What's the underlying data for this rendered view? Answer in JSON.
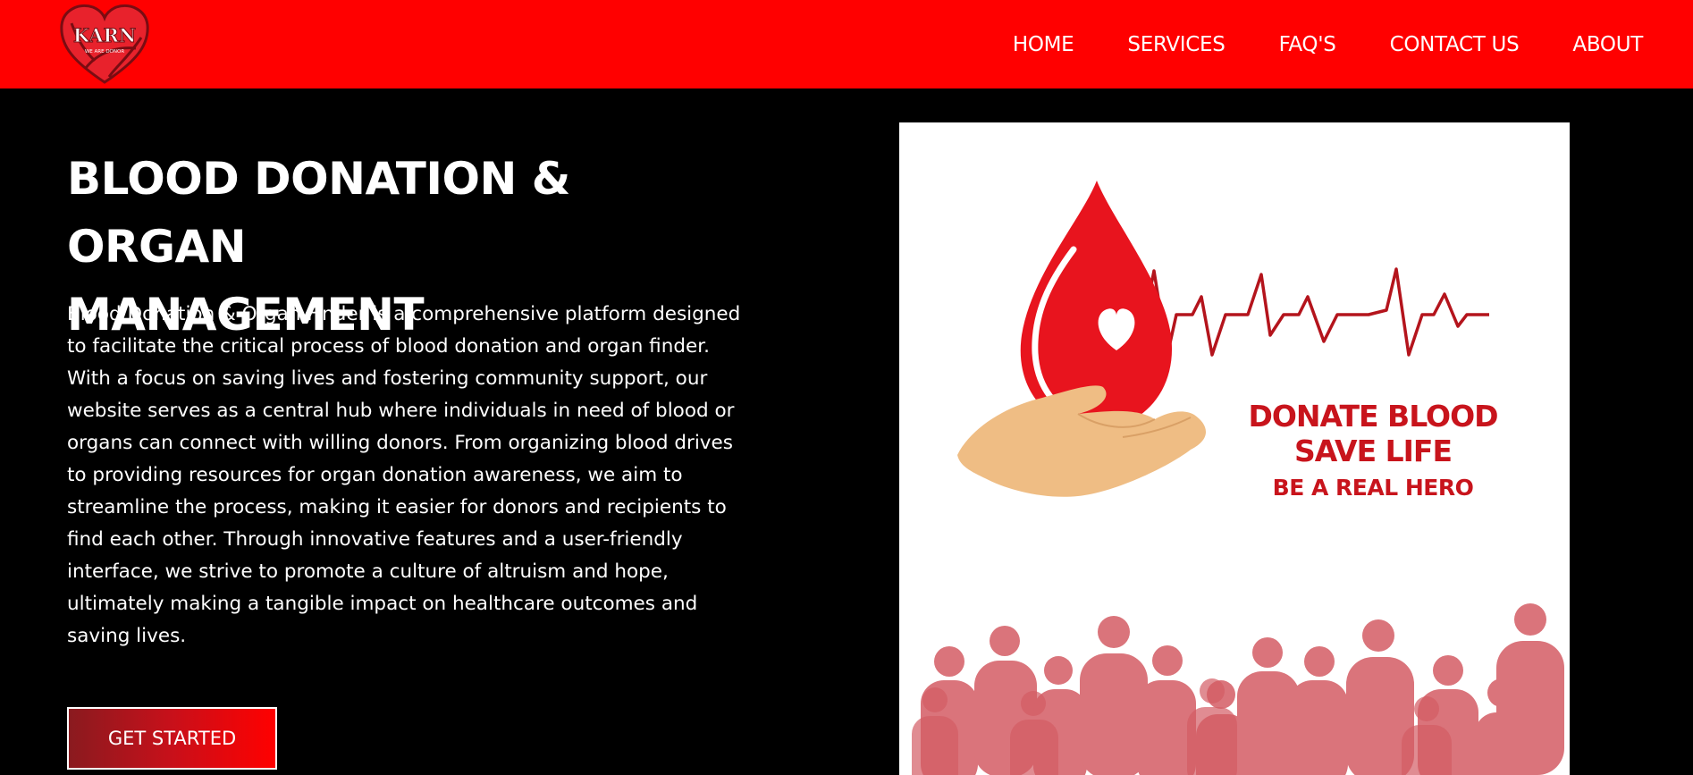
{
  "header": {
    "logo_text": "KARN",
    "logo_tagline": "WE ARE DONOR",
    "nav": [
      {
        "label": "HOME"
      },
      {
        "label": "SERVICES"
      },
      {
        "label": "FAQ'S"
      },
      {
        "label": "CONTACT US"
      },
      {
        "label": "ABOUT"
      }
    ]
  },
  "hero": {
    "title_line1": "BLOOD DONATION & ORGAN",
    "title_line2": "MANAGEMENT",
    "description": "Blood Donation & Organ Finder is a comprehensive platform designed to facilitate the critical process of blood donation and organ finder. With a focus on saving lives and fostering community support, our website serves as a central hub where individuals in need of blood or organs can connect with willing donors. From organizing blood drives to providing resources for organ donation awareness, we aim to streamline the process, making it easier for donors and recipients to find each other. Through innovative features and a user-friendly interface, we strive to promote a culture of altruism and hope, ultimately making a tangible impact on healthcare outcomes and saving lives.",
    "cta_label": "GET STARTED"
  },
  "poster": {
    "line1": "DONATE BLOOD",
    "line2": "SAVE LIFE",
    "line3": "BE A REAL HERO",
    "icons": [
      "blood-drop-icon",
      "heart-icon",
      "heartbeat-line-icon",
      "hand-icon",
      "people-crowd-icon"
    ]
  },
  "colors": {
    "header_bg": "#ff0000",
    "page_bg": "#000000",
    "poster_red": "#c8141c",
    "drop_red": "#e8141e",
    "hand_tan": "#efbd84",
    "crowd_pink": "#d45c64"
  }
}
